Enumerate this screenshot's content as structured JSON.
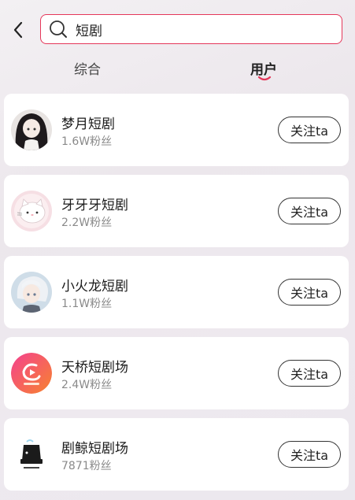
{
  "search": {
    "query": "短剧"
  },
  "tabs": [
    {
      "label": "综合",
      "active": false
    },
    {
      "label": "用户",
      "active": true
    }
  ],
  "accent_color": "#e5375a",
  "users": [
    {
      "name": "梦月短剧",
      "fans": "1.6W粉丝",
      "follow_label": "关注ta",
      "avatar": "anime-girl-dark-hair"
    },
    {
      "name": "牙牙牙短剧",
      "fans": "2.2W粉丝",
      "follow_label": "关注ta",
      "avatar": "white-cat"
    },
    {
      "name": "小火龙短剧",
      "fans": "1.1W粉丝",
      "follow_label": "关注ta",
      "avatar": "anime-boy-white-hair"
    },
    {
      "name": "天桥短剧场",
      "fans": "2.4W粉丝",
      "follow_label": "关注ta",
      "avatar": "pink-logo"
    },
    {
      "name": "剧鲸短剧场",
      "fans": "7871粉丝",
      "follow_label": "关注ta",
      "avatar": "whale-logo"
    }
  ]
}
